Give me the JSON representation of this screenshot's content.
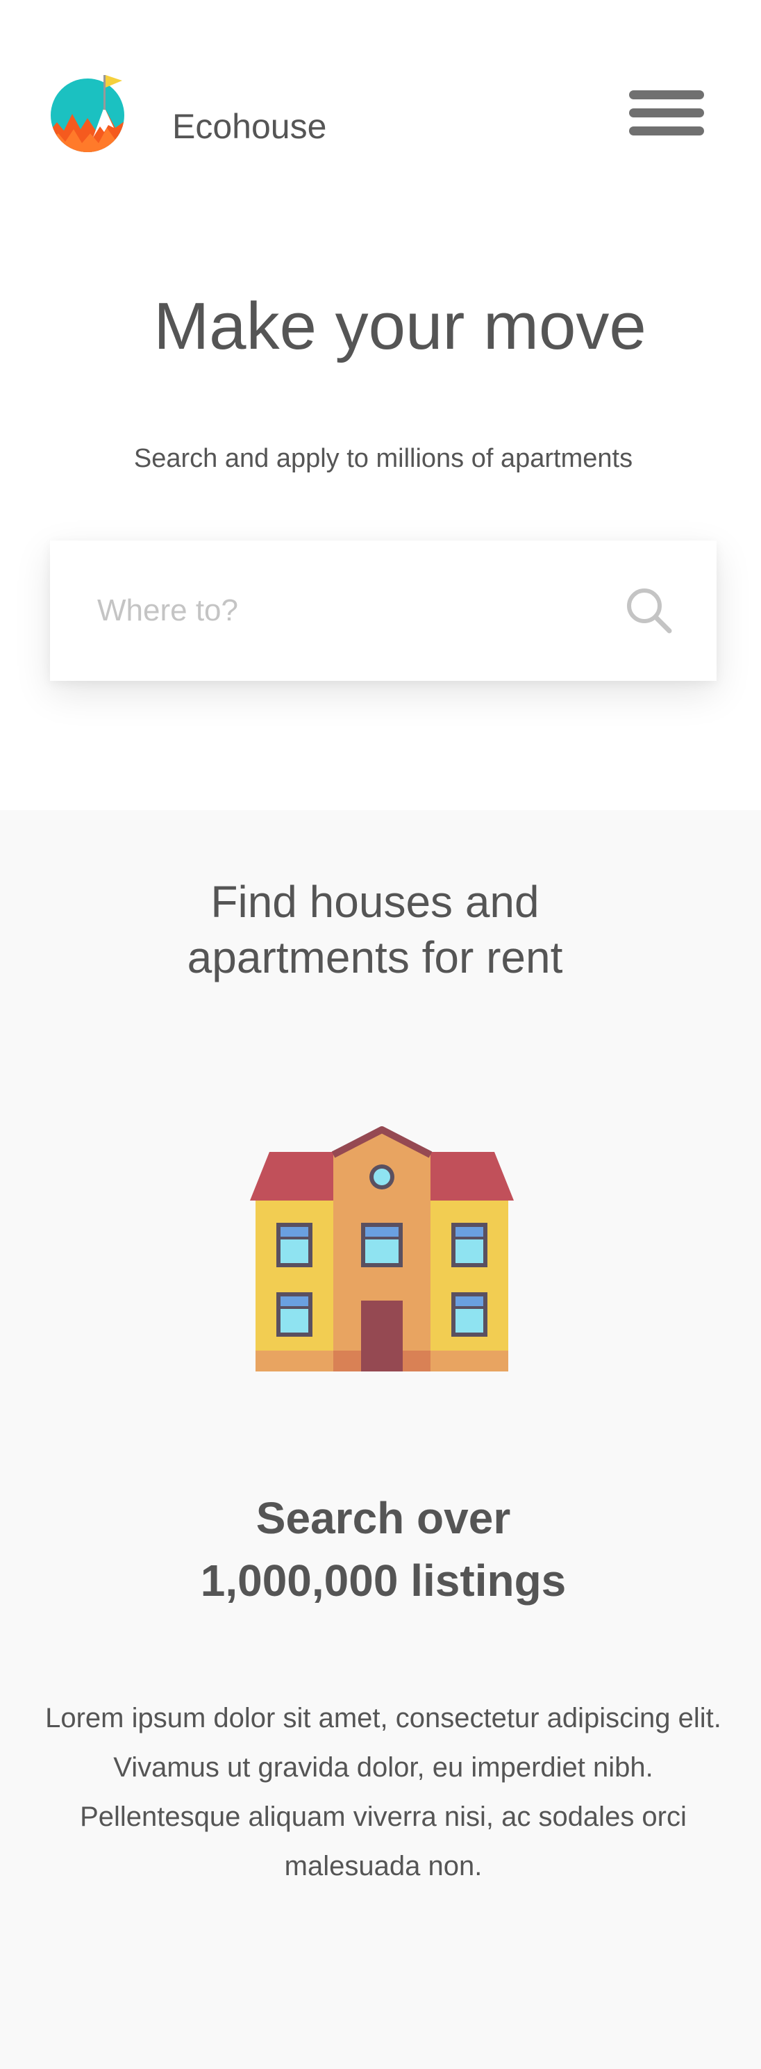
{
  "header": {
    "brand": "Ecohouse",
    "logo_icon": "mountain-flag-logo",
    "menu_icon": "hamburger-menu-icon"
  },
  "hero": {
    "title": "Make your move",
    "subtitle": "Search and apply to millions of apartments"
  },
  "search": {
    "placeholder": "Where to?",
    "value": "",
    "icon": "search-icon"
  },
  "section": {
    "title_line1": "Find houses and",
    "title_line2": "apartments for rent",
    "illustration_icon": "house-icon",
    "listing_line1": "Search over",
    "listing_line2": "1,000,000 listings",
    "body": "Lorem ipsum dolor sit amet, consectetur adipiscing elit. Vivamus ut gravida dolor, eu imperdiet nibh. Pellentesque aliquam viverra nisi, ac sodales orci malesuada non."
  },
  "colors": {
    "text": "#555555",
    "placeholder": "#c4c4c4",
    "section_background": "#f9f9f9",
    "logo_teal": "#1bc1c1",
    "logo_orange": "#f55a1e",
    "logo_flag": "#f5d03c",
    "roof_red": "#c1505a",
    "wall_yellow": "#f2cd52",
    "tower_orange": "#e8a461",
    "door_maroon": "#954952",
    "window_glass": "#8fe3f1"
  }
}
